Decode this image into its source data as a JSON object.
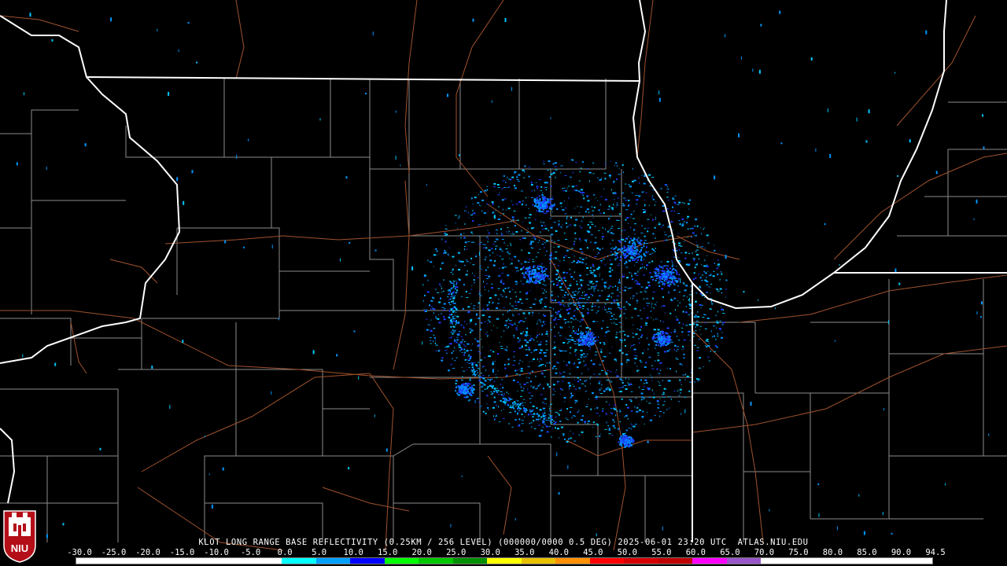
{
  "product_caption": "KLOT LONG RANGE BASE REFLECTIVITY (0.25KM / 256 LEVEL) (000000/0000 0.5 DEG) 2025-06-01 23:20 UTC  ATLAS.NIU.EDU",
  "logo_text": "NIU",
  "colors": {
    "background": "#000000",
    "state_border": "#ffffff",
    "county_border": "#8c8c8c",
    "highway": "#a0522d",
    "radar_light": "#00c8ff",
    "radar_mid": "#0096ff",
    "radar_dark": "#1e3cff",
    "logo_red": "#b40f19"
  },
  "color_scale": {
    "labels": [
      "-30.0",
      "-25.0",
      "-20.0",
      "-15.0",
      "-10.0",
      "-5.0",
      "0.0",
      "5.0",
      "10.0",
      "15.0",
      "20.0",
      "25.0",
      "30.0",
      "35.0",
      "40.0",
      "45.0",
      "50.0",
      "55.0",
      "60.0",
      "65.0",
      "70.0",
      "75.0",
      "80.0",
      "85.0",
      "90.0",
      "94.5"
    ],
    "colors": [
      "#ffffff",
      "#ffffff",
      "#ffffff",
      "#ffffff",
      "#ffffff",
      "#ffffff",
      "#00ffff",
      "#00a0ff",
      "#0000ff",
      "#00ff00",
      "#00c800",
      "#009000",
      "#ffff00",
      "#e7c000",
      "#ff9000",
      "#ff0000",
      "#d60000",
      "#c00000",
      "#ff00ff",
      "#9955c9",
      "#ffffff",
      "#ffffff",
      "#ffffff",
      "#ffffff",
      "#ffffff"
    ]
  },
  "map_features": {
    "state_borders": [
      "Wisconsin-Illinois",
      "Illinois-Indiana",
      "Indiana-Michigan",
      "Mississippi River",
      "Lake Michigan shoreline"
    ],
    "radar_site": "KLOT"
  }
}
